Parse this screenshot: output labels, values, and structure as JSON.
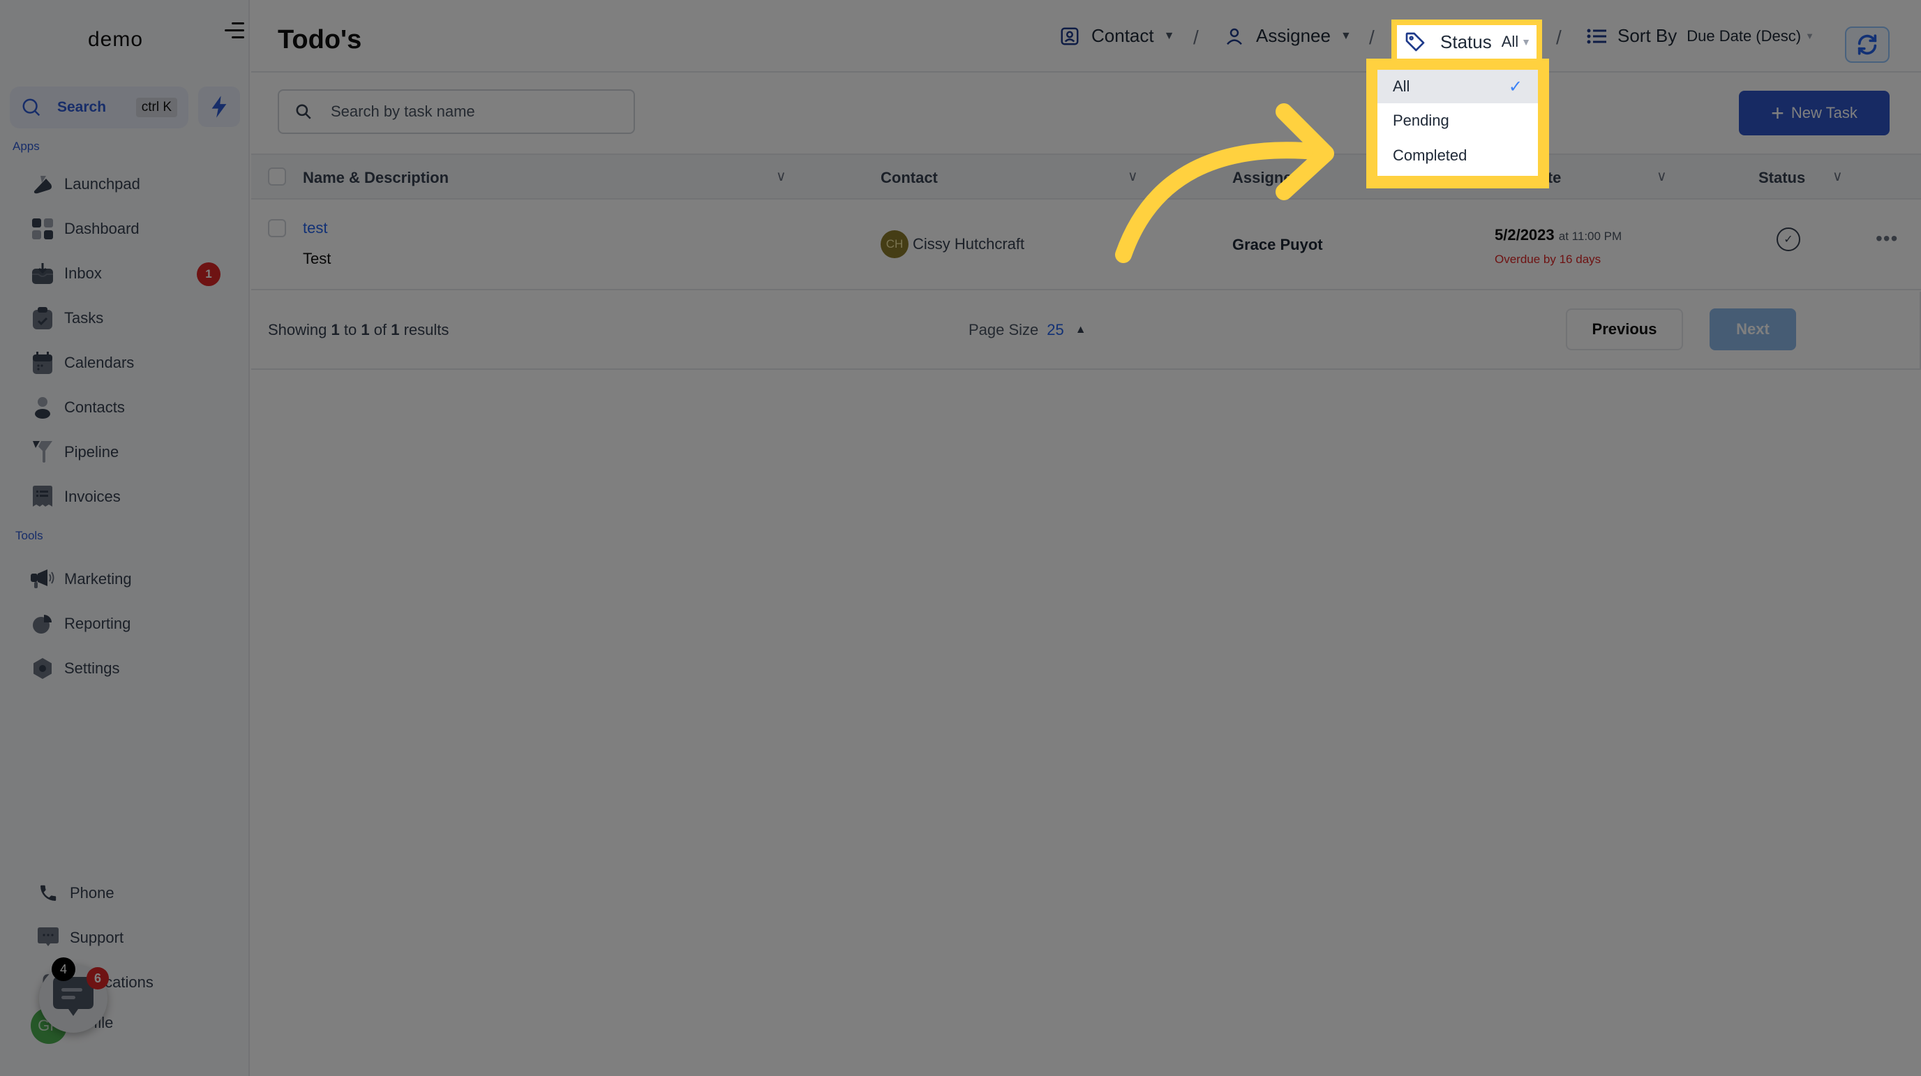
{
  "sidebar": {
    "logo": "demo",
    "search_label": "Search",
    "search_shortcut": "ctrl K",
    "section_apps": "Apps",
    "apps": [
      {
        "label": "Launchpad",
        "icon": "launchpad-icon"
      },
      {
        "label": "Dashboard",
        "icon": "dashboard-icon"
      },
      {
        "label": "Inbox",
        "icon": "inbox-icon",
        "badge": "1"
      },
      {
        "label": "Tasks",
        "icon": "tasks-icon"
      },
      {
        "label": "Calendars",
        "icon": "calendar-icon"
      },
      {
        "label": "Contacts",
        "icon": "contacts-icon"
      },
      {
        "label": "Pipeline",
        "icon": "pipeline-icon"
      },
      {
        "label": "Invoices",
        "icon": "invoices-icon"
      }
    ],
    "section_tools": "Tools",
    "tools": [
      {
        "label": "Marketing",
        "icon": "megaphone-icon"
      },
      {
        "label": "Reporting",
        "icon": "reporting-icon"
      },
      {
        "label": "Settings",
        "icon": "settings-icon"
      }
    ],
    "bottom": [
      {
        "label": "Phone",
        "icon": "phone-icon"
      },
      {
        "label": "Support",
        "icon": "support-icon"
      },
      {
        "label": "Notifications",
        "icon": "bell-icon",
        "badge": "4"
      },
      {
        "label": "Profile",
        "icon": "avatar",
        "initials": "GP"
      }
    ],
    "chat_badge": "6"
  },
  "header": {
    "title": "Todo's",
    "filters": {
      "contact": "Contact",
      "assignee": "Assignee",
      "status_label": "Status",
      "status_value": "All",
      "sort_label": "Sort By",
      "sort_value": "Due Date (Desc)"
    },
    "separator": "/"
  },
  "status_dropdown": {
    "options": [
      "All",
      "Pending",
      "Completed"
    ],
    "selected": "All"
  },
  "toolbar": {
    "search_placeholder": "Search by task name",
    "new_task_label": "New Task"
  },
  "table": {
    "columns": [
      "Name & Description",
      "Contact",
      "Assignee",
      "Due Date",
      "Status"
    ],
    "rows": [
      {
        "name": "test",
        "description": "Test",
        "contact_initials": "CH",
        "contact": "Cissy Hutchcraft",
        "assignee": "Grace Puyot",
        "due_date": "5/2/2023",
        "due_time": "at 11:00 PM",
        "overdue": "Overdue by 16 days"
      }
    ]
  },
  "footer": {
    "showing_prefix": "Showing",
    "from": "1",
    "to_word": "to",
    "to": "1",
    "of_word": "of",
    "total": "1",
    "results_word": "results",
    "page_size_label": "Page Size",
    "page_size_value": "25",
    "previous_label": "Previous",
    "next_label": "Next"
  },
  "annotation": {
    "highlight_color": "#ffd13f",
    "overlay": "dimmed"
  }
}
